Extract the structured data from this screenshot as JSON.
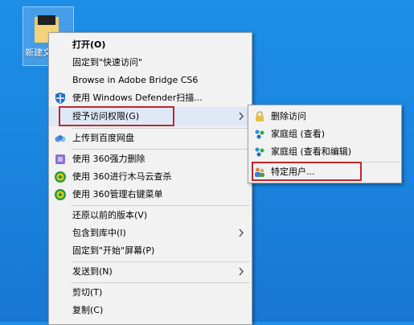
{
  "desktop": {
    "icon_label": "新建文"
  },
  "context_menu": {
    "items": [
      {
        "label": "打开(O)",
        "bold": true
      },
      {
        "label": "固定到\"快速访问\""
      },
      {
        "label": "Browse in Adobe Bridge CS6"
      },
      {
        "label": "使用 Windows Defender扫描..."
      },
      {
        "label": "授予访问权限(G)"
      },
      {
        "label": "上传到百度网盘"
      },
      {
        "label": "使用 360强力删除"
      },
      {
        "label": "使用 360进行木马云查杀"
      },
      {
        "label": "使用 360管理右键菜单"
      },
      {
        "label": "还原以前的版本(V)"
      },
      {
        "label": "包含到库中(I)"
      },
      {
        "label": "固定到\"开始\"屏幕(P)"
      },
      {
        "label": "发送到(N)"
      },
      {
        "label": "剪切(T)"
      },
      {
        "label": "复制(C)"
      }
    ]
  },
  "submenu": {
    "items": [
      {
        "label": "删除访问"
      },
      {
        "label": "家庭组 (查看)"
      },
      {
        "label": "家庭组 (查看和编辑)"
      },
      {
        "label": "特定用户..."
      }
    ]
  },
  "colors": {
    "highlight_border": "#c0262c",
    "desktop": "#1a86df"
  }
}
